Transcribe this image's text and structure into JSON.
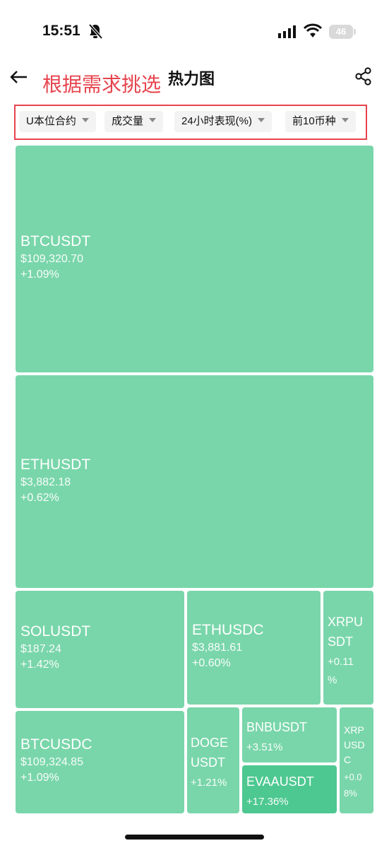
{
  "status_bar": {
    "time": "15:51",
    "battery": "46"
  },
  "header": {
    "annotation": "根据需求挑选",
    "title": "热力图"
  },
  "filters": [
    {
      "label": "U本位合约"
    },
    {
      "label": "成交量"
    },
    {
      "label": "24小时表现(%)"
    },
    {
      "label": "前10币种"
    }
  ],
  "tiles": [
    {
      "symbol": "BTCUSDT",
      "price": "$109,320.70",
      "change": "+1.09%"
    },
    {
      "symbol": "ETHUSDT",
      "price": "$3,882.18",
      "change": "+0.62%"
    },
    {
      "symbol": "SOLUSDT",
      "price": "$187.24",
      "change": "+1.42%"
    },
    {
      "symbol": "ETHUSDC",
      "price": "$3,881.61",
      "change": "+0.60%"
    },
    {
      "symbol_line1": "XRPU",
      "symbol_line2": "SDT",
      "change_line1": "+0.11",
      "change_line2": "%"
    },
    {
      "symbol": "BTCUSDC",
      "price": "$109,324.85",
      "change": "+1.09%"
    },
    {
      "symbol_line1": "DOGE",
      "symbol_line2": "USDT",
      "change": "+1.21%"
    },
    {
      "symbol": "BNBUSDT",
      "change": "+3.51%"
    },
    {
      "symbol": "EVAAUSDT",
      "change": "+17.36%"
    },
    {
      "symbol_line1": "XRP",
      "symbol_line2": "USD",
      "symbol_line3": "C",
      "change_line1": "+0.0",
      "change_line2": "8%"
    }
  ],
  "colors": {
    "tile": "#79d6aa",
    "tile_strong": "#4ec891",
    "highlight": "#e6444e"
  }
}
